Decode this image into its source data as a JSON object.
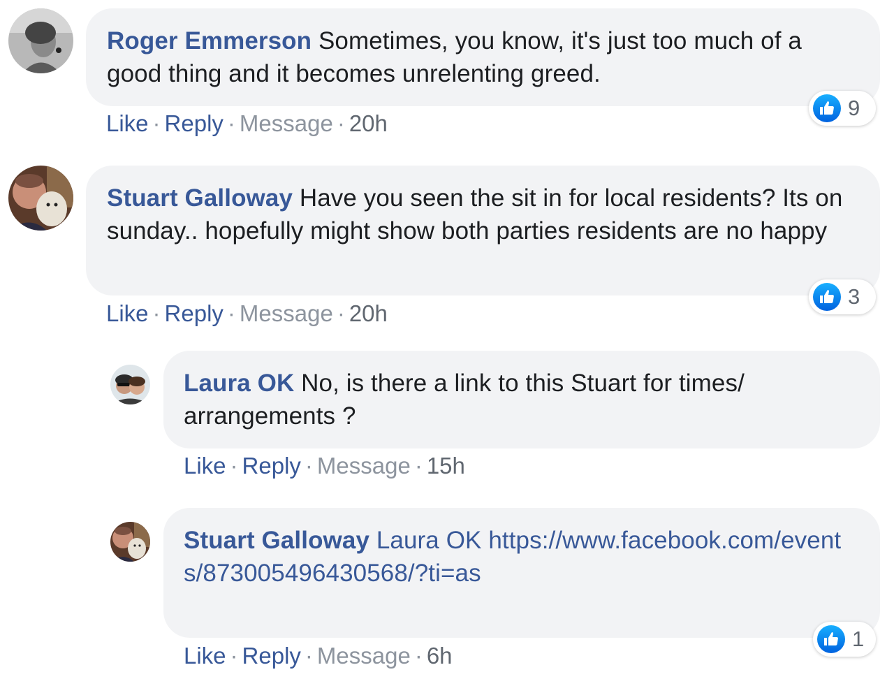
{
  "actions": {
    "like": "Like",
    "reply": "Reply",
    "message": "Message",
    "separator": "·"
  },
  "comments": [
    {
      "author": "Roger Emmerson",
      "text": "Sometimes, you know, it's just too much of a good thing and it becomes unrelenting greed.",
      "time": "20h",
      "reactions": {
        "icon": "thumbs-up-icon",
        "count": "9"
      }
    },
    {
      "author": "Stuart Galloway",
      "text": "Have you seen the sit in for local residents? Its on sunday.. hopefully might show both parties residents are no happy",
      "time": "20h",
      "reactions": {
        "icon": "thumbs-up-icon",
        "count": "3"
      }
    }
  ],
  "replies": [
    {
      "author": "Laura OK",
      "text": "No, is there a link to this Stuart for times/ arrangements ?",
      "time": "15h"
    },
    {
      "author": "Stuart Galloway",
      "tag": "Laura OK",
      "link": "https://www.facebook.com/events/873005496430568/?ti=as",
      "time": "6h",
      "reactions": {
        "icon": "thumbs-up-icon",
        "count": "1"
      }
    }
  ],
  "colors": {
    "link_blue": "#385898",
    "bubble_bg": "#f2f3f5",
    "muted": "#8d949e",
    "like_blue": "#1877f2"
  }
}
